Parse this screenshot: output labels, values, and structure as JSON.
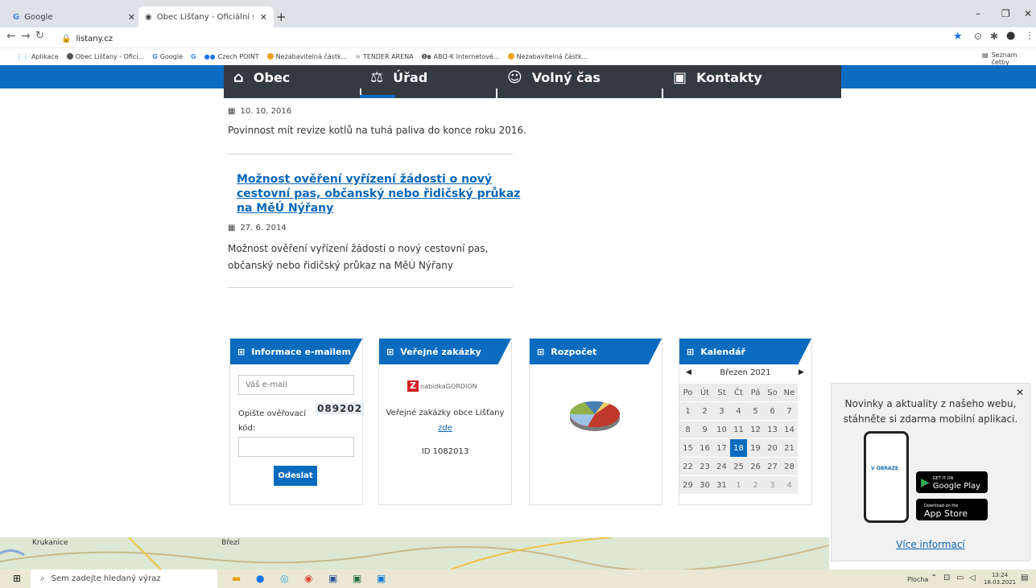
{
  "browser": {
    "tabs": [
      {
        "title": "Google"
      },
      {
        "title": "Obec Lišťany - Oficiální stránka o"
      }
    ],
    "url": "listany.cz",
    "bookmarks": [
      "Aplikace",
      "Obec Lišťany - Ofici...",
      "Google",
      "",
      "Czech POINT",
      "Nezabavitelná částk...",
      "TENDER ARENA",
      "ABO-K Internetové...",
      "Nezabavitelná částk..."
    ],
    "reading_list": "Seznam četby"
  },
  "menu": {
    "items": [
      "Obec",
      "Úřad",
      "Volný čas",
      "Kontakty"
    ]
  },
  "news": [
    {
      "date": "10. 10. 2016",
      "text": "Povinnost mít revize kotlů na tuhá paliva do konce roku 2016."
    },
    {
      "title_lines": [
        "Možnost ověření vyřízení žádosti o nový",
        "cestovní pas, občanský nebo řidičský průkaz",
        "na MěÚ Nýřany"
      ],
      "date": "27. 6. 2014",
      "text_lines": [
        "Možnost ověření vyřízení žádosti o nový cestovní pas,",
        "občanský nebo řidičský průkaz na MěÚ Nýřany"
      ]
    }
  ],
  "widgets": {
    "email": {
      "title": "Informace e-mailem",
      "placeholder": "Váš e-mail",
      "code_label_1": "Opište ověřovací",
      "code_label_2": "kód:",
      "code": "089202",
      "submit": "Odeslat"
    },
    "tenders": {
      "title": "Veřejné zakázky",
      "logo": "nabidkaGORDION",
      "text": "Veřejné zakázky obce Lišťany",
      "link": "zde",
      "id": "ID 1082013"
    },
    "budget": {
      "title": "Rozpočet"
    },
    "calendar": {
      "title": "Kalendář",
      "month": "Březen 2021",
      "days": [
        "Po",
        "Út",
        "St",
        "Čt",
        "Pá",
        "So",
        "Ne"
      ],
      "weeks": [
        [
          "1",
          "2",
          "3",
          "4",
          "5",
          "6",
          "7"
        ],
        [
          "8",
          "9",
          "10",
          "11",
          "12",
          "13",
          "14"
        ],
        [
          "15",
          "16",
          "17",
          "18",
          "19",
          "20",
          "21"
        ],
        [
          "22",
          "23",
          "24",
          "25",
          "26",
          "27",
          "28"
        ],
        [
          "29",
          "30",
          "31",
          "1",
          "2",
          "3",
          "4"
        ]
      ],
      "today": "18"
    }
  },
  "popup": {
    "text_line1": "Novinky a aktuality z našeho webu,",
    "text_line2": "stáhněte si zdarma mobilní aplikaci.",
    "google_play_small": "GET IT ON",
    "google_play": "Google Play",
    "appstore_small": "Download on the",
    "appstore": "App Store",
    "more": "Více informací",
    "app_label": "V OBRAZE"
  },
  "map": {
    "place1": "Krukanice",
    "place2": "Březí"
  },
  "taskbar": {
    "search": "Sem zadejte hledaný výraz",
    "desktop": "Plocha",
    "time": "13:24",
    "date": "18.03.2021"
  },
  "colors": {
    "brand_blue": "#0b6cbf",
    "menu_dark": "#333a40"
  }
}
